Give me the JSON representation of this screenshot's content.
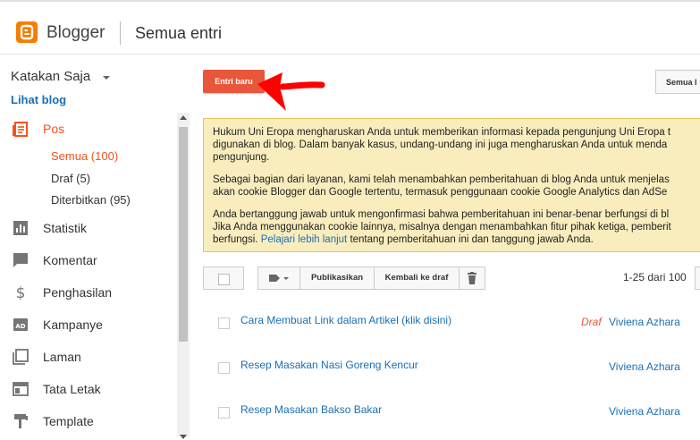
{
  "header": {
    "brand": "Blogger",
    "page_title": "Semua entri",
    "logo_icon": "blogger-logo-icon"
  },
  "sidebar": {
    "blog_name": "Katakan Saja",
    "view_blog": "Lihat blog",
    "items": [
      {
        "label": "Pos",
        "icon": "posts-icon",
        "active": true
      },
      {
        "label": "Statistik",
        "icon": "stats-icon"
      },
      {
        "label": "Komentar",
        "icon": "comment-icon"
      },
      {
        "label": "Penghasilan",
        "icon": "dollar-icon"
      },
      {
        "label": "Kampanye",
        "icon": "ad-icon"
      },
      {
        "label": "Laman",
        "icon": "pages-icon"
      },
      {
        "label": "Tata Letak",
        "icon": "layout-icon"
      },
      {
        "label": "Template",
        "icon": "template-icon"
      }
    ],
    "sub_items": [
      {
        "label": "Semua (100)",
        "active": true
      },
      {
        "label": "Draf (5)"
      },
      {
        "label": "Diterbitkan (95)"
      }
    ]
  },
  "main": {
    "new_post_label": "Entri baru",
    "all_posts_label": "Semua l",
    "notice": {
      "p1_line1": "Hukum Uni Eropa mengharuskan Anda untuk memberikan informasi kepada pengunjung Uni Eropa t",
      "p1_line2": "digunakan di blog. Dalam banyak kasus, undang-undang ini juga mengharuskan Anda untuk menda",
      "p1_line3": "pengunjung.",
      "p2_line1": "Sebagai bagian dari layanan, kami telah menambahkan pemberitahuan di blog Anda untuk menjelas",
      "p2_line2": "akan cookie Blogger dan Google tertentu, termasuk penggunaan cookie Google Analytics dan AdSe",
      "p3_line1": "Anda bertanggung jawab untuk mengonfirmasi bahwa pemberitahuan ini benar-benar berfungsi di bl",
      "p3_line2": "Jika Anda menggunakan cookie lainnya, misalnya dengan menambahkan fitur pihak ketiga, pemberit",
      "p3_line3_pre": "berfungsi. ",
      "p3_link": "Pelajari lebih lanjut",
      "p3_line3_post": " tentang pemberitahuan ini dan tanggung jawab Anda."
    },
    "toolbar": {
      "label_icon": "label-icon",
      "publish": "Publikasikan",
      "revert": "Kembali ke draf",
      "delete_icon": "trash-icon",
      "pager": "1-25 dari 100"
    },
    "posts": [
      {
        "title": "Cara Membuat Link dalam Artikel (klik disini)",
        "status": "Draf",
        "author": "Viviena Azhara"
      },
      {
        "title": "Resep Masakan Nasi Goreng Kencur",
        "status": "",
        "author": "Viviena Azhara"
      },
      {
        "title": "Resep Masakan Bakso Bakar",
        "status": "",
        "author": "Viviena Azhara"
      }
    ]
  },
  "colors": {
    "accent": "#f4511e",
    "button": "#e8573c",
    "link": "#1a6fb5",
    "notice_bg": "#f9edbe",
    "annotation_arrow": "#ff0000"
  }
}
